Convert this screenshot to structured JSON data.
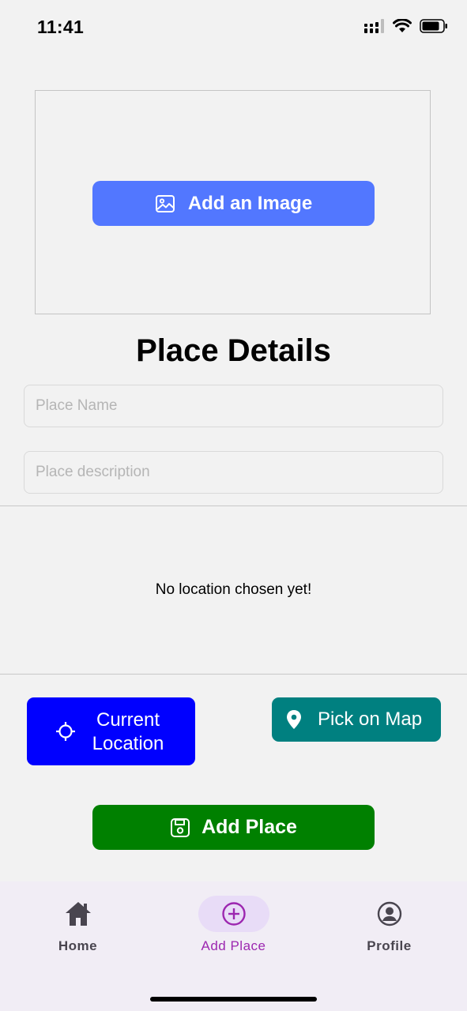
{
  "status_bar": {
    "time": "11:41"
  },
  "image_picker": {
    "button_label": "Add an Image"
  },
  "page": {
    "title": "Place Details"
  },
  "form": {
    "name_placeholder": "Place Name",
    "name_value": "",
    "description_placeholder": "Place description",
    "description_value": ""
  },
  "location": {
    "empty_text": "No location chosen yet!",
    "current_location_label": "Current Location",
    "pick_on_map_label": "Pick on Map"
  },
  "submit": {
    "label": "Add Place"
  },
  "bottom_nav": {
    "items": [
      {
        "label": "Home",
        "icon": "home-icon"
      },
      {
        "label": "Add Place",
        "icon": "add-circle-icon",
        "active": true
      },
      {
        "label": "Profile",
        "icon": "profile-icon"
      }
    ]
  },
  "colors": {
    "add_image_button": "#5277ff",
    "current_location_button": "#0000ff",
    "pick_on_map_button": "#008080",
    "add_place_button": "#008000",
    "nav_active": "#9c27b0"
  }
}
